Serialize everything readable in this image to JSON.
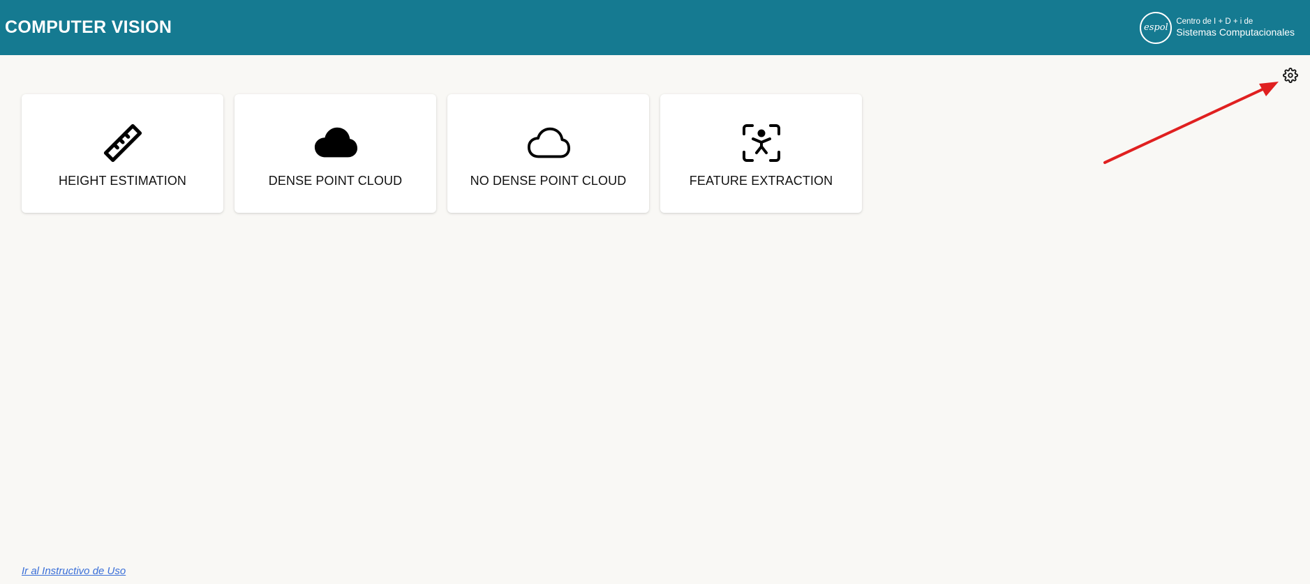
{
  "header": {
    "title": "COMPUTER VISION",
    "brand": {
      "logo_text": "espol",
      "line1": "Centro de I + D + i de",
      "line2": "Sistemas Computacionales"
    },
    "background_color": "#157a91"
  },
  "settings": {
    "icon": "gear-icon"
  },
  "annotation": {
    "type": "arrow",
    "color": "#e02020",
    "points_to": "settings-button"
  },
  "cards": [
    {
      "label": "HEIGHT ESTIMATION",
      "icon": "ruler-icon"
    },
    {
      "label": "DENSE POINT CLOUD",
      "icon": "cloud-filled-icon"
    },
    {
      "label": "NO DENSE POINT CLOUD",
      "icon": "cloud-outline-icon"
    },
    {
      "label": "FEATURE EXTRACTION",
      "icon": "person-scan-icon"
    }
  ],
  "footer": {
    "link_text": "Ir al Instructivo de Uso"
  }
}
